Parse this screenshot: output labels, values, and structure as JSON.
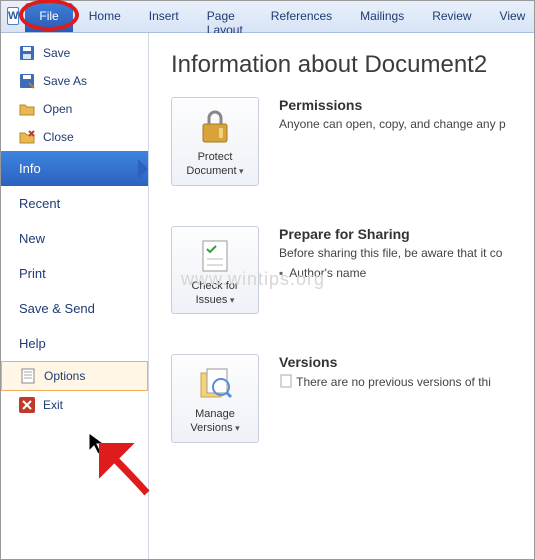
{
  "tabs": {
    "file": "File",
    "home": "Home",
    "insert": "Insert",
    "pageLayout": "Page Layout",
    "references": "References",
    "mailings": "Mailings",
    "review": "Review",
    "view": "View"
  },
  "sidebar": {
    "save": "Save",
    "saveAs": "Save As",
    "open": "Open",
    "close": "Close",
    "info": "Info",
    "recent": "Recent",
    "new": "New",
    "print": "Print",
    "saveSend": "Save & Send",
    "help": "Help",
    "options": "Options",
    "exit": "Exit"
  },
  "main": {
    "title": "Information about Document2",
    "permissions": {
      "btn": "Protect Document",
      "heading": "Permissions",
      "text": "Anyone can open, copy, and change any p"
    },
    "prepare": {
      "btn": "Check for Issues",
      "heading": "Prepare for Sharing",
      "text": "Before sharing this file, be aware that it co",
      "bullet": "Author's name"
    },
    "versions": {
      "btn": "Manage Versions",
      "heading": "Versions",
      "text": "There are no previous versions of thi"
    }
  },
  "watermark": "www.wintips.org"
}
